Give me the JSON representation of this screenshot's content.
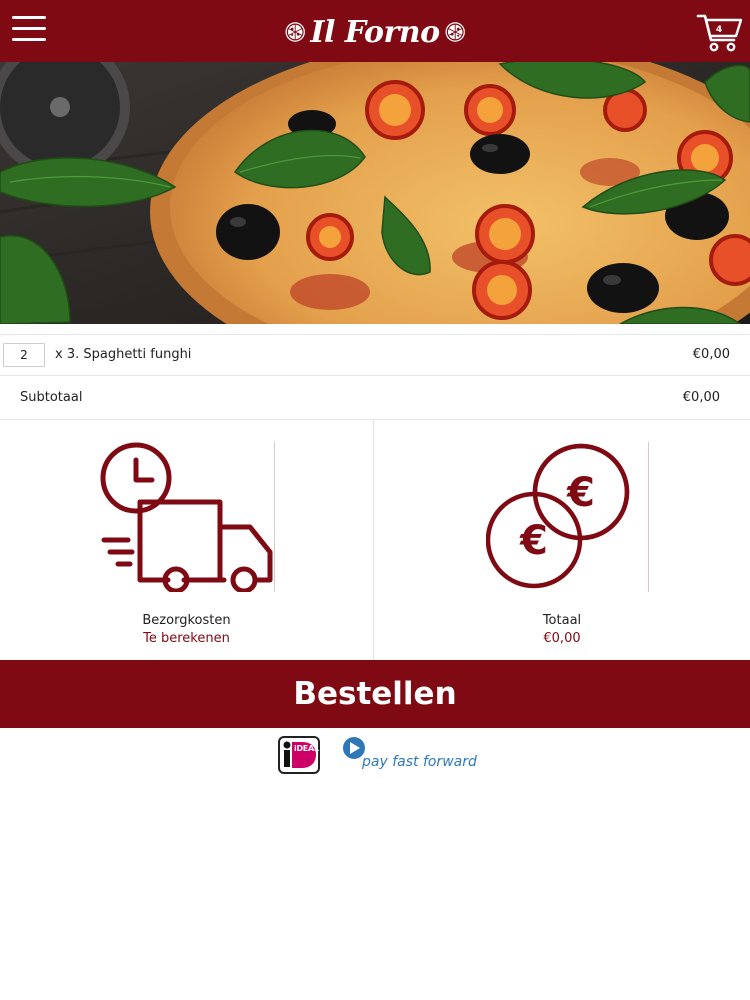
{
  "header": {
    "logo_text": "Il Forno",
    "cart_count": "4"
  },
  "order": {
    "items": [
      {
        "quantity": "2",
        "description": "x 3. Spaghetti funghi",
        "price": "€0,00"
      }
    ],
    "subtotal_label": "Subtotaal",
    "subtotal_value": "€0,00"
  },
  "delivery": {
    "label": "Bezorgkosten",
    "value": "Te berekenen"
  },
  "total": {
    "label": "Totaal",
    "value": "€0,00"
  },
  "order_button": {
    "label": "Bestellen"
  },
  "payment": {
    "ideal_logo_text": "iDEAL",
    "pff_logo_text": "pay fast forward"
  },
  "colors": {
    "brand": "#7f0a13",
    "background": "#ffffff",
    "payfastforward_blue": "#2f78b7"
  },
  "icons": [
    "menu-icon",
    "cart-icon",
    "pizza-icon",
    "clock-icon",
    "delivery-truck-icon",
    "euro-coins-icon",
    "ideal-logo",
    "payfastforward-logo"
  ]
}
